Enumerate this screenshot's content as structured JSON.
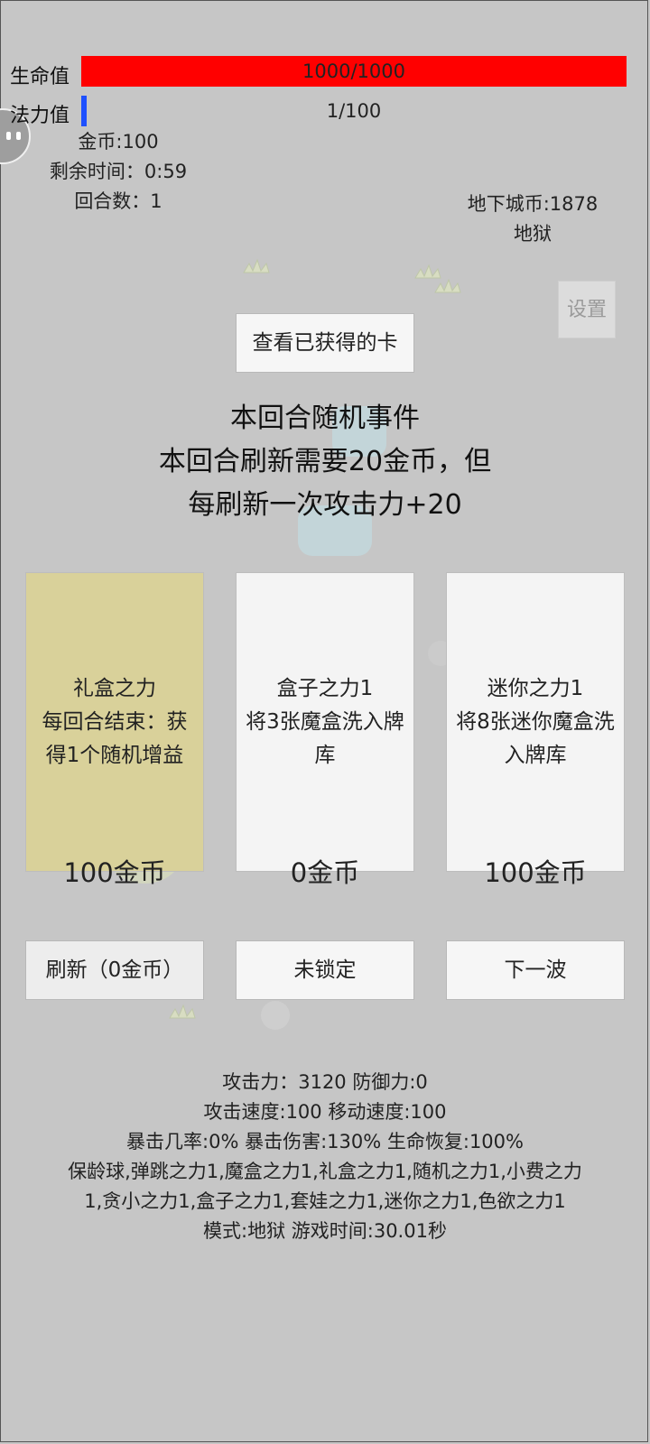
{
  "hud": {
    "hp_label": "生命值",
    "hp_value": "1000/1000",
    "hp_fraction": 1.0,
    "mp_label": "法力值",
    "mp_value": "1/100",
    "mp_fraction": 0.01,
    "gold": "金币:100",
    "time_left": "剩余时间：0:59",
    "round": "回合数：1",
    "dungeon_coins": "地下城币:1878",
    "difficulty": "地狱"
  },
  "settings_label": "设置",
  "view_cards_label": "查看已获得的卡",
  "event": {
    "line1": "本回合随机事件",
    "line2": "本回合刷新需要20金币，但",
    "line3": "每刷新一次攻击力+20"
  },
  "cards": [
    {
      "text": "礼盒之力\n每回合结束：获\n得1个随机增益",
      "price": "100金币",
      "bg": "#d9d19a"
    },
    {
      "text": "盒子之力1\n将3张魔盒洗入牌\n库",
      "price": "0金币",
      "bg": "#f4f4f4"
    },
    {
      "text": "迷你之力1\n将8张迷你魔盒洗\n入牌库",
      "price": "100金币",
      "bg": "#f4f4f4"
    }
  ],
  "actions": {
    "refresh": "刷新（0金币）",
    "lock": "未锁定",
    "next_wave": "下一波"
  },
  "stats": {
    "line1": "攻击力：3120 防御力:0",
    "line2": "攻击速度:100 移动速度:100",
    "line3": "暴击几率:0% 暴击伤害:130% 生命恢复:100%",
    "line4": "保龄球,弹跳之力1,魔盒之力1,礼盒之力1,随机之力1,小费之力",
    "line5": "1,贪小之力1,盒子之力1,套娃之力1,迷你之力1,色欲之力1",
    "line6": "模式:地狱 游戏时间:30.01秒"
  },
  "colors": {
    "background": "#c6c6c6",
    "hp": "#ff0000",
    "mp": "#1e50ff",
    "selected_card": "#d9d19a"
  },
  "icons": [
    "avatar-icon",
    "grass-sprite",
    "slime-sprite"
  ]
}
